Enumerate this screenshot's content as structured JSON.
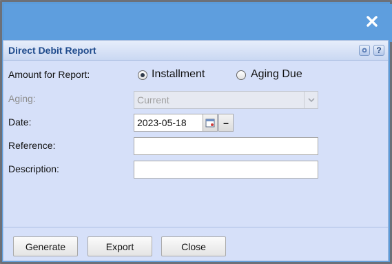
{
  "dialog": {
    "title": "Direct Debit Report",
    "close_glyph": "✕",
    "help_glyph": "?"
  },
  "form": {
    "amount_label": "Amount for Report:",
    "options": [
      {
        "label": "Installment",
        "selected": true
      },
      {
        "label": "Aging Due",
        "selected": false
      }
    ],
    "aging_label": "Aging:",
    "aging_value": "Current",
    "date_label": "Date:",
    "date_value": "2023-05-18",
    "date_clear_glyph": "–",
    "reference_label": "Reference:",
    "reference_value": "",
    "description_label": "Description:",
    "description_value": ""
  },
  "buttons": {
    "generate": "Generate",
    "export": "Export",
    "close": "Close"
  },
  "icons": {
    "close": "close-icon",
    "gear": "gear-icon",
    "help": "help-icon",
    "calendar": "calendar-icon",
    "dropdown": "chevron-down-icon"
  }
}
